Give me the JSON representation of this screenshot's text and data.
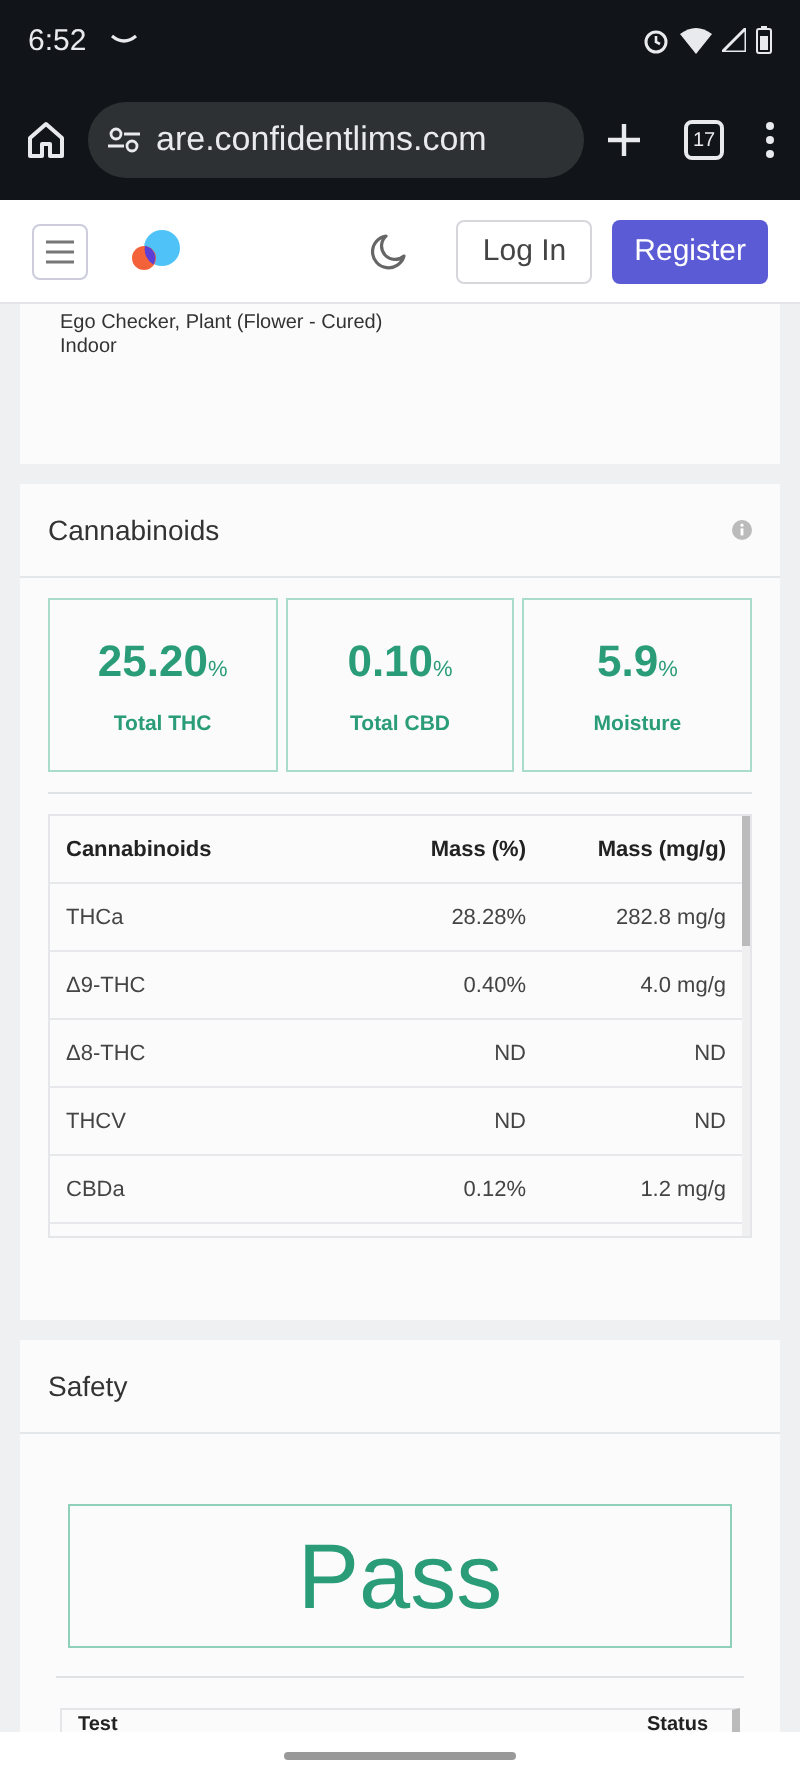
{
  "status_bar": {
    "time": "6:52"
  },
  "browser": {
    "url": "are.confidentlims.com",
    "tab_count": "17"
  },
  "header": {
    "login": "Log In",
    "register": "Register"
  },
  "product": {
    "lines": [
      "Ego Checker, Plant (Flower - Cured)",
      "Indoor"
    ]
  },
  "cannabinoids": {
    "title": "Cannabinoids",
    "stats": [
      {
        "value": "25.20",
        "unit": "%",
        "label": "Total THC"
      },
      {
        "value": "0.10",
        "unit": "%",
        "label": "Total CBD"
      },
      {
        "value": "5.9",
        "unit": "%",
        "label": "Moisture"
      }
    ],
    "table": {
      "columns": [
        "Cannabinoids",
        "Mass (%)",
        "Mass (mg/g)"
      ],
      "rows": [
        [
          "THCa",
          "28.28%",
          "282.8 mg/g"
        ],
        [
          "Δ9-THC",
          "0.40%",
          "4.0 mg/g"
        ],
        [
          "Δ8-THC",
          "ND",
          "ND"
        ],
        [
          "THCV",
          "ND",
          "ND"
        ],
        [
          "CBDa",
          "0.12%",
          "1.2 mg/g"
        ]
      ]
    }
  },
  "safety": {
    "title": "Safety",
    "result": "Pass",
    "table": {
      "columns": [
        "Test",
        "Status"
      ]
    }
  }
}
